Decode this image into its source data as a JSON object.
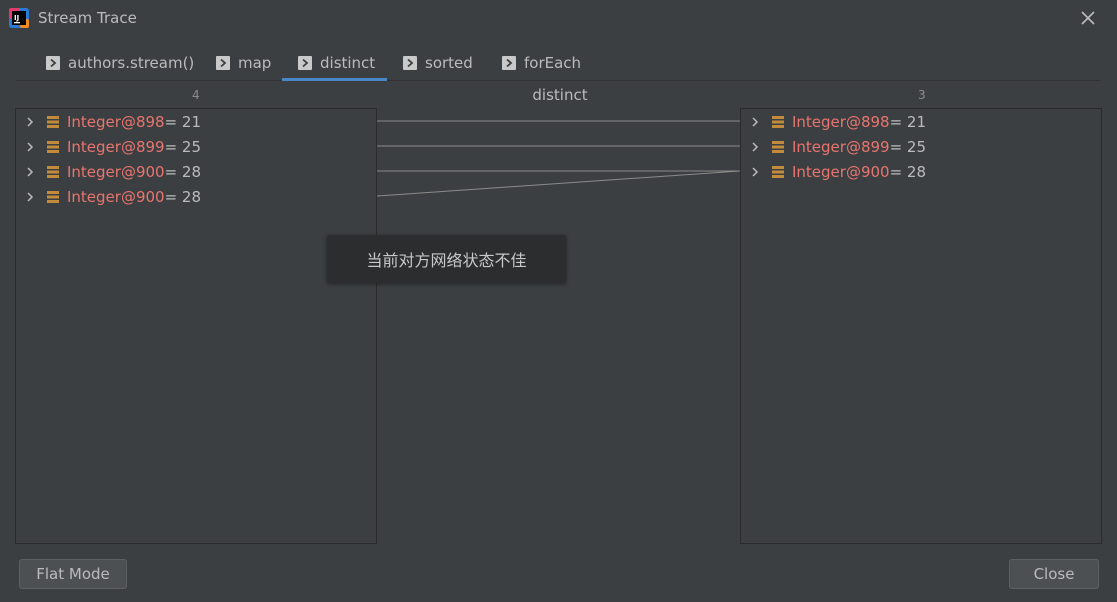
{
  "window": {
    "title": "Stream Trace",
    "logo_icon": "intellij-logo-icon",
    "close_icon": "close-icon"
  },
  "tabs": [
    {
      "label": "authors.stream()",
      "icon": "play-arrow-icon",
      "active": false
    },
    {
      "label": "map",
      "icon": "play-arrow-icon",
      "active": false
    },
    {
      "label": "distinct",
      "icon": "play-arrow-icon",
      "active": true
    },
    {
      "label": "sorted",
      "icon": "play-arrow-icon",
      "active": false
    },
    {
      "label": "forEach",
      "icon": "play-arrow-icon",
      "active": false
    }
  ],
  "step": {
    "name": "distinct",
    "left_count": "4",
    "right_count": "3"
  },
  "left_items": [
    {
      "name": "Integer@898",
      "value": " = 21"
    },
    {
      "name": "Integer@899",
      "value": " = 25"
    },
    {
      "name": "Integer@900",
      "value": " = 28"
    },
    {
      "name": "Integer@900",
      "value": " = 28"
    }
  ],
  "right_items": [
    {
      "name": "Integer@898",
      "value": " = 21"
    },
    {
      "name": "Integer@899",
      "value": " = 25"
    },
    {
      "name": "Integer@900",
      "value": " = 28"
    }
  ],
  "mappings": [
    [
      0,
      0
    ],
    [
      1,
      1
    ],
    [
      2,
      2
    ],
    [
      3,
      2
    ]
  ],
  "toast": {
    "message": "当前对方网络状态不佳"
  },
  "buttons": {
    "flat_mode": "Flat Mode",
    "close": "Close"
  },
  "colors": {
    "background": "#3c3f41",
    "accent": "#4a88c7",
    "object_name": "#e8746f",
    "object_icon": "#c28b3b",
    "link_line": "#8a8a8a"
  }
}
